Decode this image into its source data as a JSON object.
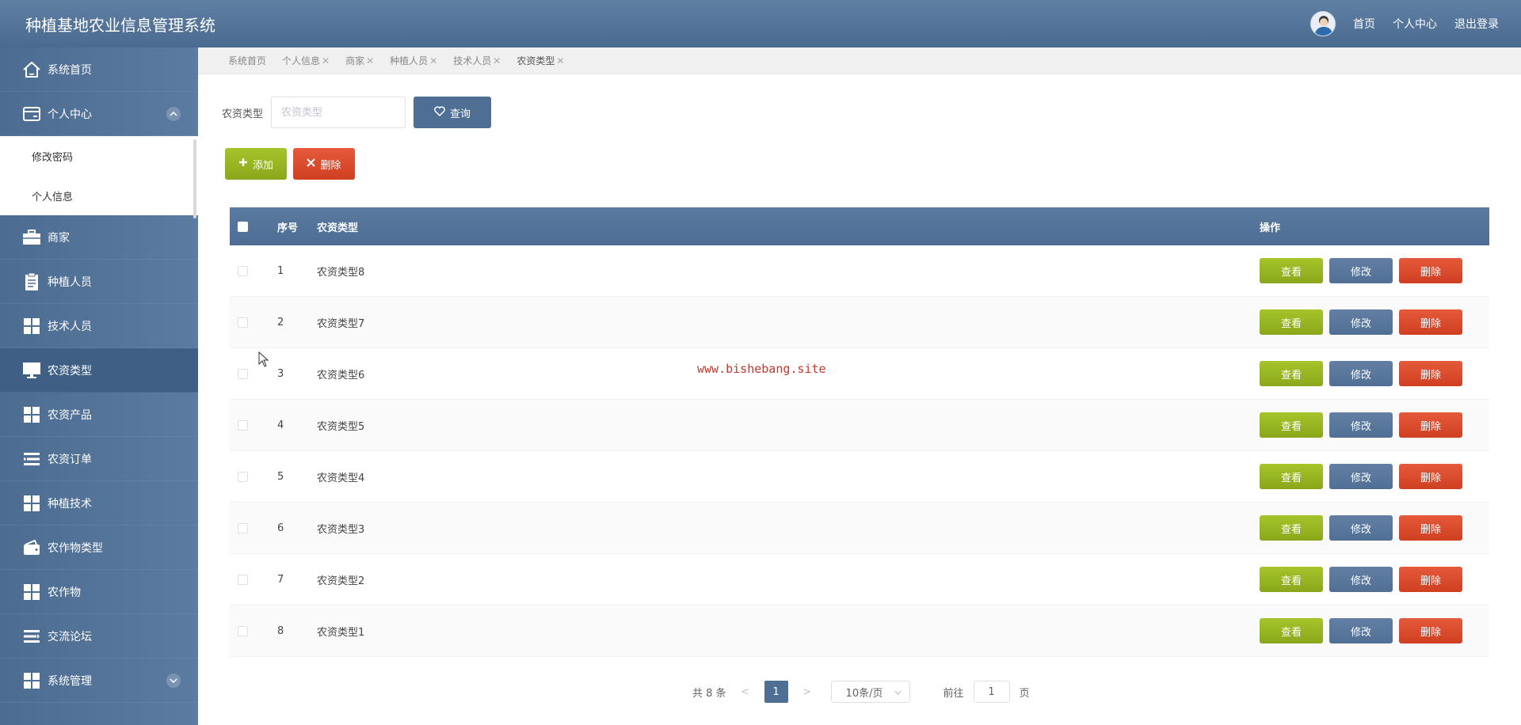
{
  "header": {
    "title": "种植基地农业信息管理系统",
    "links": [
      "首页",
      "个人中心",
      "退出登录"
    ]
  },
  "sidebar": {
    "items": [
      {
        "label": "系统首页",
        "icon": "home-icon"
      },
      {
        "label": "个人中心",
        "icon": "card-icon",
        "expanded": true,
        "sub": [
          "修改密码",
          "个人信息"
        ]
      },
      {
        "label": "商家",
        "icon": "briefcase-icon"
      },
      {
        "label": "种植人员",
        "icon": "clipboard-icon"
      },
      {
        "label": "技术人员",
        "icon": "grid-icon"
      },
      {
        "label": "农资类型",
        "icon": "monitor-icon",
        "active": true
      },
      {
        "label": "农资产品",
        "icon": "grid-icon"
      },
      {
        "label": "农资订单",
        "icon": "list-icon"
      },
      {
        "label": "种植技术",
        "icon": "grid-icon"
      },
      {
        "label": "农作物类型",
        "icon": "wallet-icon"
      },
      {
        "label": "农作物",
        "icon": "grid-icon"
      },
      {
        "label": "交流论坛",
        "icon": "list-icon"
      },
      {
        "label": "系统管理",
        "icon": "grid-icon"
      }
    ]
  },
  "tabs": [
    {
      "label": "系统首页",
      "closable": false
    },
    {
      "label": "个人信息",
      "closable": true
    },
    {
      "label": "商家",
      "closable": true
    },
    {
      "label": "种植人员",
      "closable": true
    },
    {
      "label": "技术人员",
      "closable": true
    },
    {
      "label": "农资类型",
      "closable": true
    }
  ],
  "search": {
    "label": "农资类型",
    "placeholder": "农资类型",
    "value": "",
    "button": "查询"
  },
  "toolbar": {
    "add": "添加",
    "delete": "删除"
  },
  "table": {
    "columns": [
      "序号",
      "农资类型",
      "操作"
    ],
    "rows": [
      {
        "no": "1",
        "type": "农资类型8"
      },
      {
        "no": "2",
        "type": "农资类型7"
      },
      {
        "no": "3",
        "type": "农资类型6"
      },
      {
        "no": "4",
        "type": "农资类型5"
      },
      {
        "no": "5",
        "type": "农资类型4"
      },
      {
        "no": "6",
        "type": "农资类型3"
      },
      {
        "no": "7",
        "type": "农资类型2"
      },
      {
        "no": "8",
        "type": "农资类型1"
      }
    ],
    "row_actions": {
      "view": "查看",
      "edit": "修改",
      "delete": "删除"
    }
  },
  "watermark": "www.bishebang.site",
  "pagination": {
    "total_text": "共 8 条",
    "prev": "<",
    "current_page": "1",
    "next": ">",
    "page_size": "10条/页",
    "goto_label": "前往",
    "goto_value": "1",
    "page_suffix": "页"
  },
  "colors": {
    "header": "#4e6e93",
    "green": "#94b020",
    "red": "#d9482a",
    "blue": "#56749a"
  }
}
